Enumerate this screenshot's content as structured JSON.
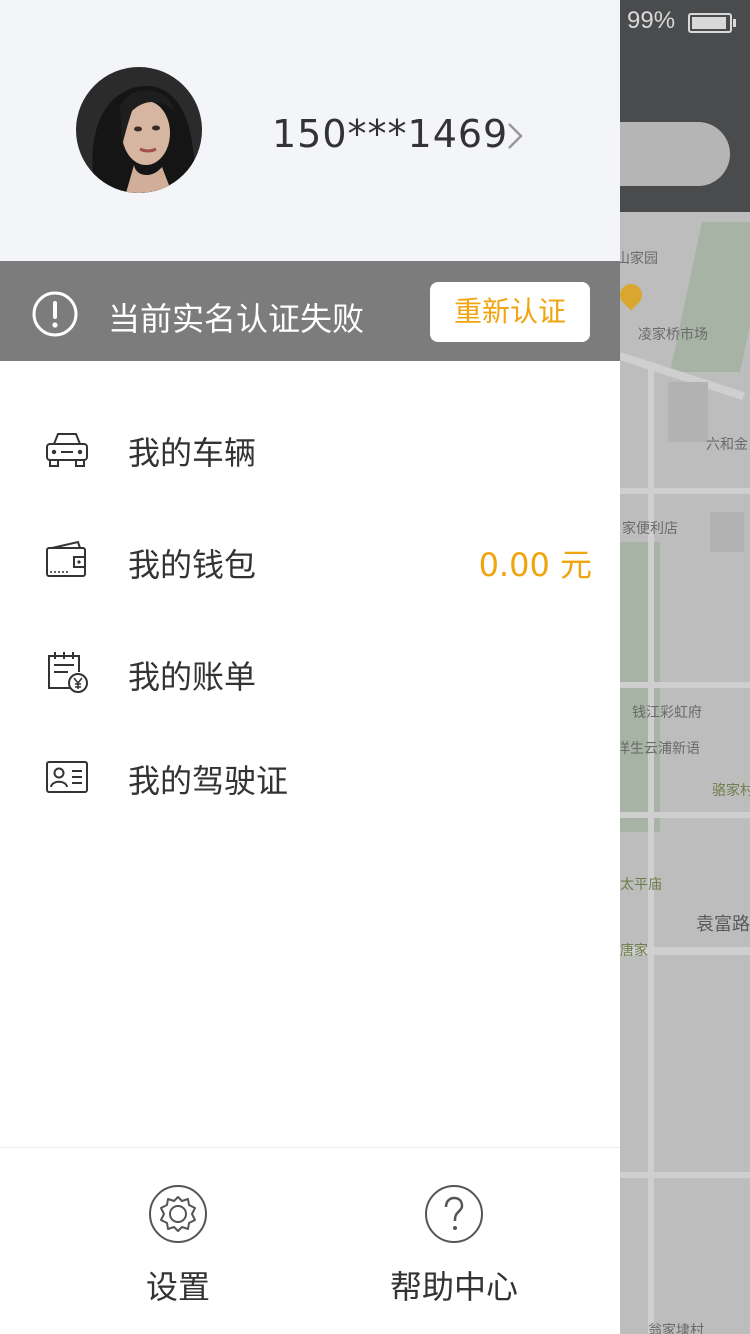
{
  "status_bar": {
    "battery_percent": "99%"
  },
  "profile": {
    "phone": "150***1469"
  },
  "auth_banner": {
    "message": "当前实名认证失败",
    "button_label": "重新认证"
  },
  "menu": [
    {
      "label": "我的车辆",
      "icon": "car-icon"
    },
    {
      "label": "我的钱包",
      "icon": "wallet-icon",
      "value": "0.00 元"
    },
    {
      "label": "我的账单",
      "icon": "bill-icon"
    },
    {
      "label": "我的驾驶证",
      "icon": "license-icon"
    }
  ],
  "footer": {
    "settings_label": "设置",
    "help_label": "帮助中心"
  },
  "map_labels": {
    "l1": "山家园",
    "l2": "凌家桥市场",
    "l3": "六和金",
    "l4": "家便利店",
    "l5": "钱江彩虹府",
    "l6": "洋生云浦新语",
    "l7": "骆家村",
    "l8": "太平庙",
    "l9": "袁富路",
    "l10": "唐家",
    "l11": "翁家埭村"
  },
  "colors": {
    "accent": "#f0a40e",
    "auth_bar": "#7c7c7c",
    "profile_bg": "#f4f5f9",
    "text": "#333333"
  }
}
